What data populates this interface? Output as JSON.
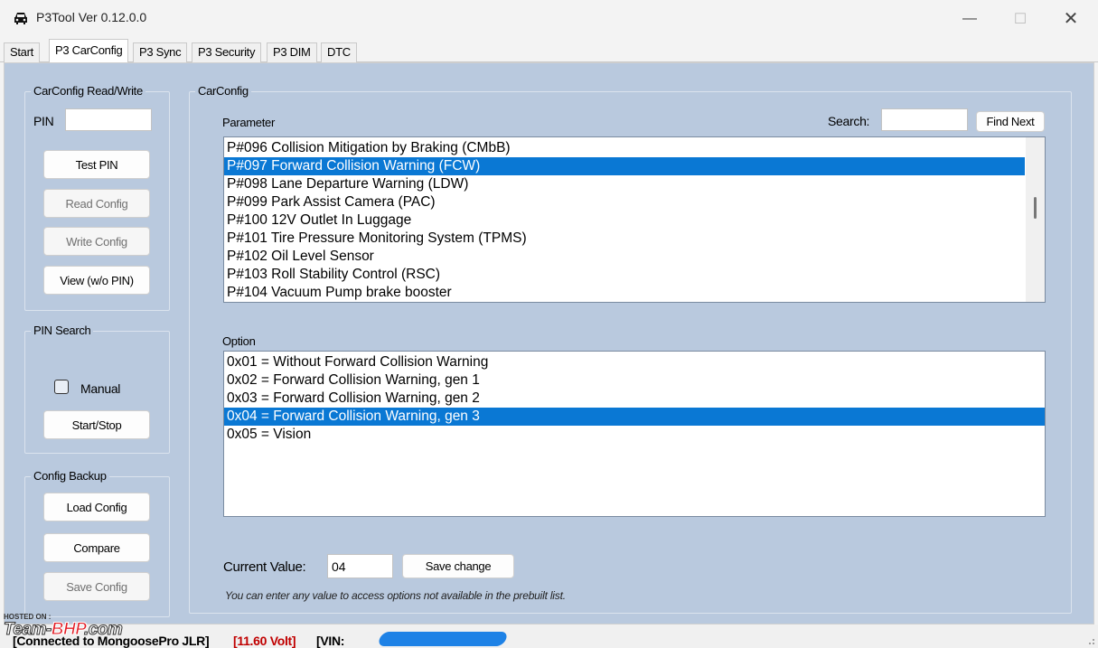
{
  "window": {
    "title": "P3Tool Ver 0.12.0.0",
    "minimize_glyph": "—",
    "maximize_glyph": "☐",
    "close_glyph": "✕"
  },
  "tabs": [
    {
      "label": "Start"
    },
    {
      "label": "P3 CarConfig",
      "active": true
    },
    {
      "label": "P3 Sync"
    },
    {
      "label": "P3 Security"
    },
    {
      "label": "P3 DIM"
    },
    {
      "label": "DTC"
    }
  ],
  "readwrite": {
    "group_label": "CarConfig Read/Write",
    "pin_label": "PIN",
    "pin_value": "",
    "buttons": [
      {
        "label": "Test PIN",
        "enabled": true
      },
      {
        "label": "Read Config",
        "enabled": false
      },
      {
        "label": "Write Config",
        "enabled": false
      },
      {
        "label": "View (w/o PIN)",
        "enabled": true
      }
    ]
  },
  "pin_search": {
    "group_label": "PIN Search",
    "manual_label": "Manual",
    "manual_checked": false,
    "start_stop_label": "Start/Stop"
  },
  "backup": {
    "group_label": "Config Backup",
    "buttons": [
      {
        "label": "Load Config",
        "enabled": true
      },
      {
        "label": "Compare",
        "enabled": true
      },
      {
        "label": "Save Config",
        "enabled": false
      }
    ]
  },
  "carconfig": {
    "group_label": "CarConfig",
    "parameter_label": "Parameter",
    "search_label": "Search:",
    "search_value": "",
    "find_next_label": "Find Next",
    "parameters": [
      {
        "text": "P#096 Collision Mitigation by Braking (CMbB)",
        "selected": false
      },
      {
        "text": "P#097 Forward Collision Warning (FCW)",
        "selected": true
      },
      {
        "text": "P#098 Lane Departure Warning (LDW)",
        "selected": false
      },
      {
        "text": "P#099 Park Assist Camera (PAC)",
        "selected": false
      },
      {
        "text": "P#100 12V Outlet In Luggage",
        "selected": false
      },
      {
        "text": "P#101 Tire Pressure Monitoring System (TPMS)",
        "selected": false
      },
      {
        "text": "P#102 Oil Level Sensor",
        "selected": false
      },
      {
        "text": "P#103 Roll Stability Control (RSC)",
        "selected": false
      },
      {
        "text": "P#104 Vacuum Pump brake booster",
        "selected": false
      }
    ],
    "option_label": "Option",
    "options": [
      {
        "text": "0x01 = Without Forward Collision Warning",
        "selected": false
      },
      {
        "text": "0x02 = Forward Collision Warning, gen 1",
        "selected": false
      },
      {
        "text": "0x03 = Forward Collision Warning, gen 2",
        "selected": false
      },
      {
        "text": "0x04 = Forward Collision Warning, gen 3",
        "selected": true
      },
      {
        "text": "0x05 = Vision",
        "selected": false
      }
    ],
    "current_value_label": "Current Value:",
    "current_value": "04",
    "save_change_label": "Save change",
    "hint": "You can enter any value to access options not available in the prebuilt list."
  },
  "status": {
    "connection": "[Connected to MongoosePro JLR]",
    "voltage": "[11.60 Volt]",
    "vin_prefix": "[VIN:",
    "colors": {
      "voltage": "#c00000",
      "redaction": "#1e82e6"
    }
  },
  "watermark": {
    "hosted_on": "HOSTED ON :",
    "brand_team": "Team-",
    "brand_bhp": "BHP",
    "brand_suffix": ".com"
  },
  "colors": {
    "panel_bg": "#b9c9de",
    "selection": "#0a78d4"
  }
}
